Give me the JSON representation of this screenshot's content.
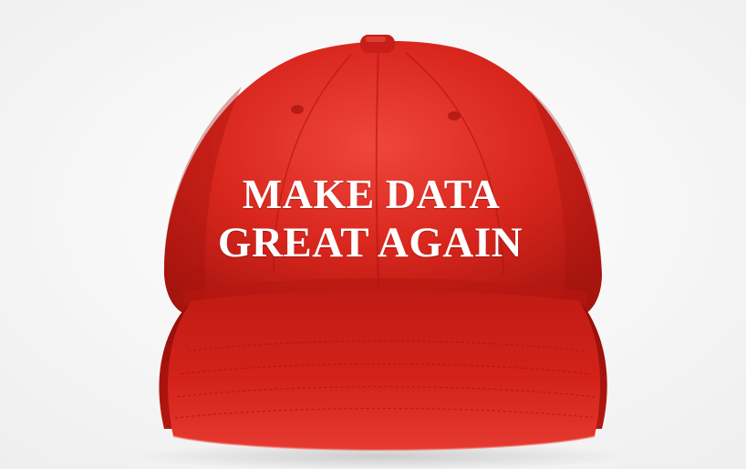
{
  "image": {
    "subject": "red-baseball-cap",
    "colors": {
      "background": "#f3f3f3",
      "cap_red": "#d8261d",
      "cap_dark": "#9e120c",
      "cap_light": "#ef463b",
      "text": "#ffffff"
    }
  },
  "cap": {
    "slogan_line_1": "MAKE DATA",
    "slogan_line_2": "GREAT AGAIN"
  }
}
